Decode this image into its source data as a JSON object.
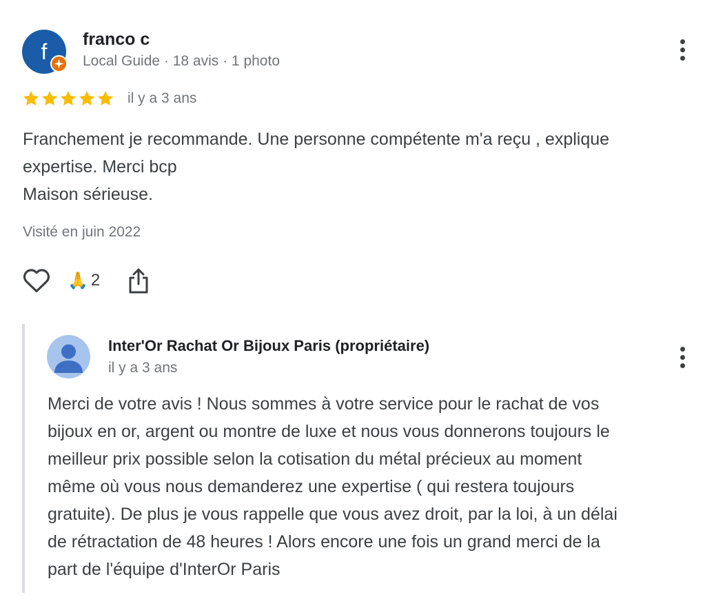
{
  "review": {
    "avatar_letter": "f",
    "avatar_color": "#1a5ca8",
    "badge_icon": "local-guide-star-icon",
    "badge_color": "#e8710a",
    "reviewer_name": "franco c",
    "reviewer_meta": "Local Guide · 18 avis · 1 photo",
    "rating": 5,
    "star_color": "#fbbc04",
    "date": "il y a 3 ans",
    "text_lines": [
      "Franchement je recommande. Une personne compétente m'a reçu , explique",
      "expertise. Merci bcp",
      "Maison sérieuse."
    ],
    "visited": "Visité en juin 2022",
    "actions": {
      "like_icon": "heart-outline-icon",
      "reaction_emoji": "🙏",
      "reaction_count": "2",
      "share_icon": "share-icon",
      "more_icon": "more-vert-icon"
    }
  },
  "owner_reply": {
    "avatar_icon": "person-icon",
    "avatar_color": "#a7c5ec",
    "name": "Inter'Or Rachat Or Bijoux Paris (propriétaire)",
    "date": "il y a 3 ans",
    "more_icon": "more-vert-icon",
    "text_lines": [
      "Merci de votre avis ! Nous sommes à votre service pour le rachat de vos",
      "bijoux en or, argent ou montre de luxe et nous vous donnerons toujours le",
      "meilleur prix possible selon la cotisation du métal précieux au moment",
      "même où vous nous demanderez une expertise ( qui restera toujours",
      "gratuite). De plus je vous rappelle que vous avez droit, par la loi, à un délai",
      "de rétractation de 48 heures ! Alors encore une fois un grand merci de la",
      "part de l'équipe d'InterOr Paris"
    ]
  }
}
